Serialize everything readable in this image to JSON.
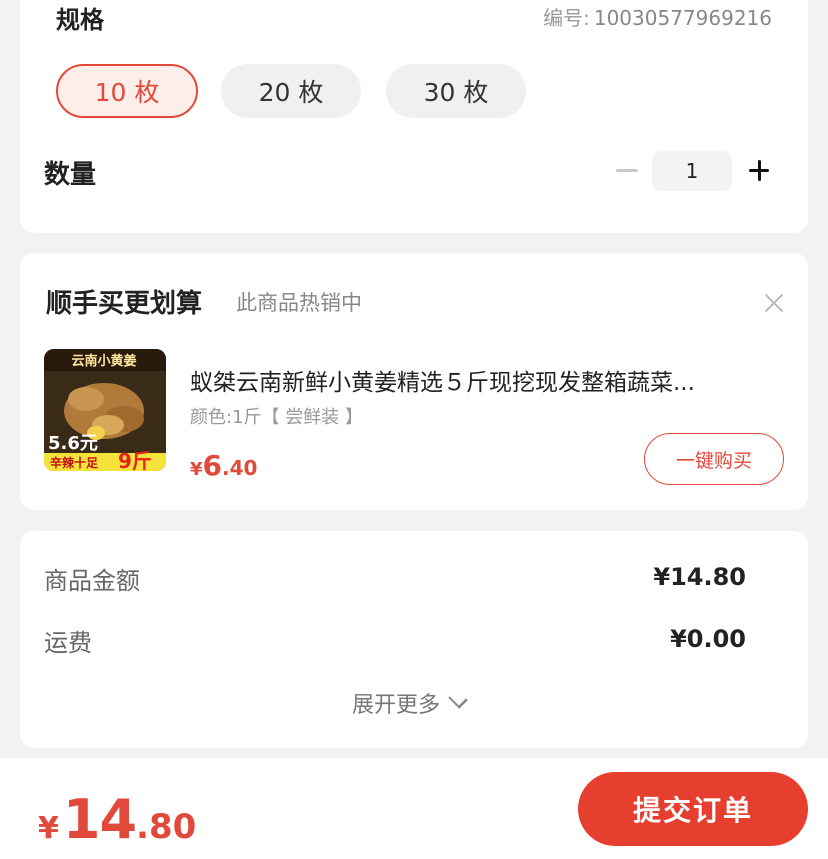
{
  "spec": {
    "title": "规格",
    "code_label": "编号:",
    "code_value": "10030577969216",
    "options": [
      "10 枚",
      "20 枚",
      "30 枚"
    ],
    "selected_index": 0
  },
  "quantity": {
    "label": "数量",
    "value": "1"
  },
  "recommend": {
    "title": "顺手买更划算",
    "subtitle": "此商品热销中",
    "product": {
      "name": "蚁桀云南新鲜小黄姜精选５斤现挖现发整箱蔬菜...",
      "attr": "颜色:1斤【 尝鲜装 】",
      "price_currency": "¥",
      "price_int": "6",
      "price_dec": ".40",
      "image_badge_top": "云南小黄姜",
      "image_badge_bottom": "辛辣十足",
      "image_badge_weight": "9斤",
      "image_badge_price": "5.6元",
      "buy_label": "一键购买"
    }
  },
  "amount": {
    "rows": [
      {
        "label": "商品金额",
        "value": "¥14.80"
      },
      {
        "label": "运费",
        "value": "¥0.00"
      }
    ],
    "expand_label": "展开更多"
  },
  "bottom": {
    "currency": "¥",
    "total_int": "14",
    "total_dec": ".80",
    "submit_label": "提交订单"
  },
  "colors": {
    "accent": "#e14a3b",
    "submit_bg": "#e63f2f",
    "page_bg": "#f2f2f2"
  }
}
